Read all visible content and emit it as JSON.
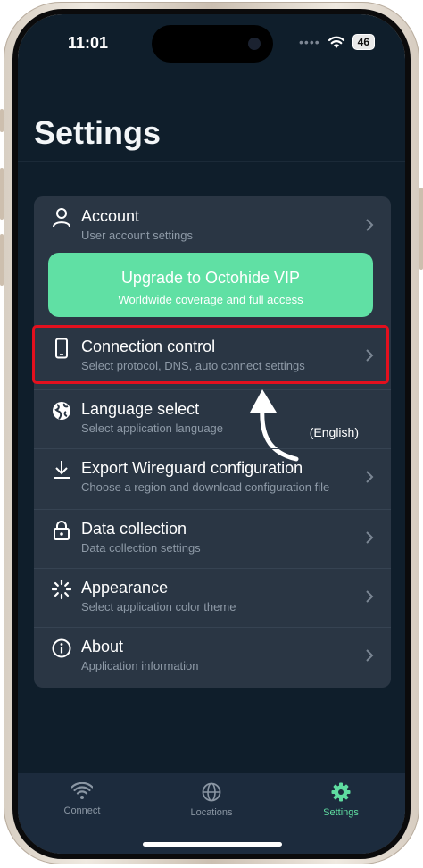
{
  "status_bar": {
    "time": "11:01",
    "battery": "46"
  },
  "page": {
    "title": "Settings"
  },
  "settings": {
    "items": [
      {
        "title": "Account",
        "subtitle": "User account settings"
      },
      {
        "title": "Connection control",
        "subtitle": "Select protocol, DNS, auto connect settings"
      },
      {
        "title": "Language select",
        "subtitle": "Select application language",
        "value": "(English)"
      },
      {
        "title": "Export Wireguard configuration",
        "subtitle": "Choose a region and download configuration file"
      },
      {
        "title": "Data collection",
        "subtitle": "Data collection settings"
      },
      {
        "title": "Appearance",
        "subtitle": "Select application color theme"
      },
      {
        "title": "About",
        "subtitle": "Application information"
      }
    ],
    "upgrade": {
      "title": "Upgrade to Octohide VIP",
      "subtitle": "Worldwide coverage and full access"
    }
  },
  "tabs": [
    {
      "label": "Connect",
      "icon": "wifi-icon"
    },
    {
      "label": "Locations",
      "icon": "globe-icon"
    },
    {
      "label": "Settings",
      "icon": "gear-icon",
      "active": true
    }
  ],
  "colors": {
    "background": "#0f1e2b",
    "card": "#2a3644",
    "accent": "#60e0a4",
    "highlight": "#e3101e",
    "tab_active": "#5fdca0"
  }
}
